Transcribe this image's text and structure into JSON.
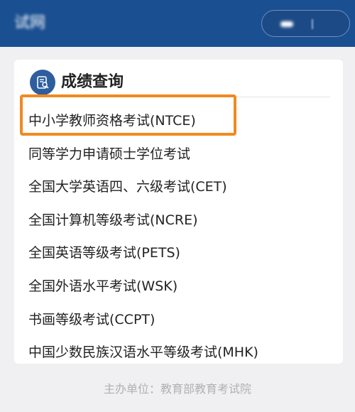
{
  "header": {
    "site_title": "试网"
  },
  "section": {
    "icon": "score-query-icon",
    "title": "成绩查询"
  },
  "exams": [
    {
      "label": "中小学教师资格考试(NTCE)"
    },
    {
      "label": "同等学力申请硕士学位考试"
    },
    {
      "label": "全国大学英语四、六级考试(CET)"
    },
    {
      "label": "全国计算机等级考试(NCRE)"
    },
    {
      "label": "全国英语等级考试(PETS)"
    },
    {
      "label": "全国外语水平考试(WSK)"
    },
    {
      "label": "书画等级考试(CCPT)"
    },
    {
      "label": "中国少数民族汉语水平等级考试(MHK)"
    }
  ],
  "footer": {
    "text": "主办单位：教育部教育考试院"
  },
  "colors": {
    "header_bg": "#1a4f91",
    "highlight": "#f08a20",
    "icon_bg": "#2e5e9e"
  }
}
